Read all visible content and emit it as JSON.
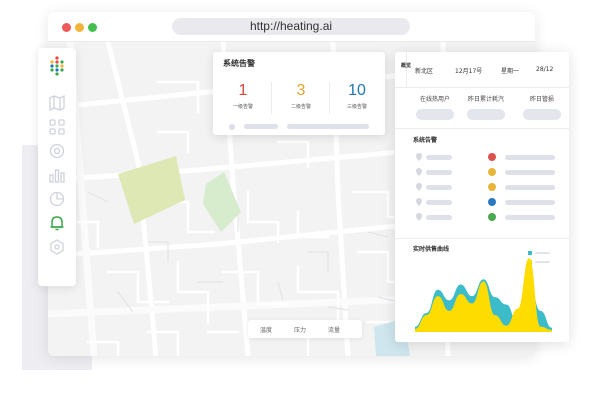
{
  "browser": {
    "url": "http://heating.ai"
  },
  "sidebar": {
    "items": [
      {
        "icon": "map-icon"
      },
      {
        "icon": "grid-icon"
      },
      {
        "icon": "settings-icon"
      },
      {
        "icon": "bar-chart-icon"
      },
      {
        "icon": "pie-chart-icon"
      },
      {
        "icon": "bell-icon",
        "active": true
      },
      {
        "icon": "hexagon-icon"
      }
    ],
    "active_color": "#3aa84a"
  },
  "alarm_panel": {
    "title": "系统告警",
    "stats": [
      {
        "value": "1",
        "label": "一级告警",
        "color": "#d9453c"
      },
      {
        "value": "3",
        "label": "二级告警",
        "color": "#e0a332"
      },
      {
        "value": "10",
        "label": "三级告警",
        "color": "#1f77b4"
      }
    ]
  },
  "overview": {
    "tab": "概览",
    "district": "新北区",
    "date": "12月17号",
    "weekday": "星期一",
    "extra": "28/12",
    "metrics": [
      {
        "label": "在线热用户"
      },
      {
        "label": "昨日累计耗汽"
      },
      {
        "label": "昨日管损"
      }
    ]
  },
  "system_alarms": {
    "title": "系统告警",
    "rows": [
      {
        "status_color": "#d9534f"
      },
      {
        "status_color": "#e8b53a"
      },
      {
        "status_color": "#e8b53a"
      },
      {
        "status_color": "#2b78c2"
      },
      {
        "status_color": "#4aa84e"
      }
    ]
  },
  "realtime_chart": {
    "title": "实时供售曲线"
  },
  "bottom_tabs": [
    "温度",
    "压力",
    "流量"
  ],
  "chart_data": {
    "type": "area",
    "series": [
      {
        "color": "#3bbcc8",
        "values": [
          5,
          18,
          40,
          30,
          45,
          34,
          50,
          33,
          26,
          8,
          46,
          20,
          4
        ]
      },
      {
        "color": "#ffdc00",
        "values": [
          3,
          16,
          34,
          20,
          36,
          27,
          48,
          16,
          6,
          22,
          70,
          5,
          2
        ]
      }
    ]
  }
}
